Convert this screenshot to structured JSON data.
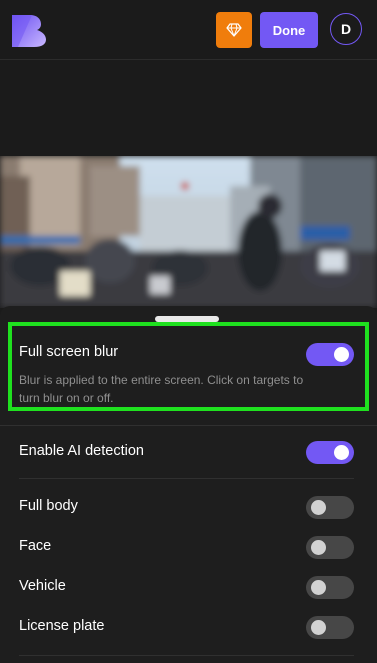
{
  "header": {
    "done_label": "Done",
    "avatar_initial": "D",
    "logo_icon": "b-logo-icon",
    "premium_icon": "diamond-icon"
  },
  "preview": {
    "description_icon": "blurred-crowd-image"
  },
  "settings": {
    "full_screen_blur": {
      "title": "Full screen blur",
      "description": "Blur is applied to the entire screen. Click on targets to turn blur on or off.",
      "enabled": true
    },
    "ai_detection": {
      "title": "Enable AI detection",
      "enabled": true
    },
    "targets": [
      {
        "label": "Full body",
        "enabled": false
      },
      {
        "label": "Face",
        "enabled": false
      },
      {
        "label": "Vehicle",
        "enabled": false
      },
      {
        "label": "License plate",
        "enabled": false
      }
    ]
  },
  "colors": {
    "accent": "#7358f4",
    "premium": "#f07d0c",
    "highlight": "#1fe11f",
    "background": "#1b1b1b"
  }
}
